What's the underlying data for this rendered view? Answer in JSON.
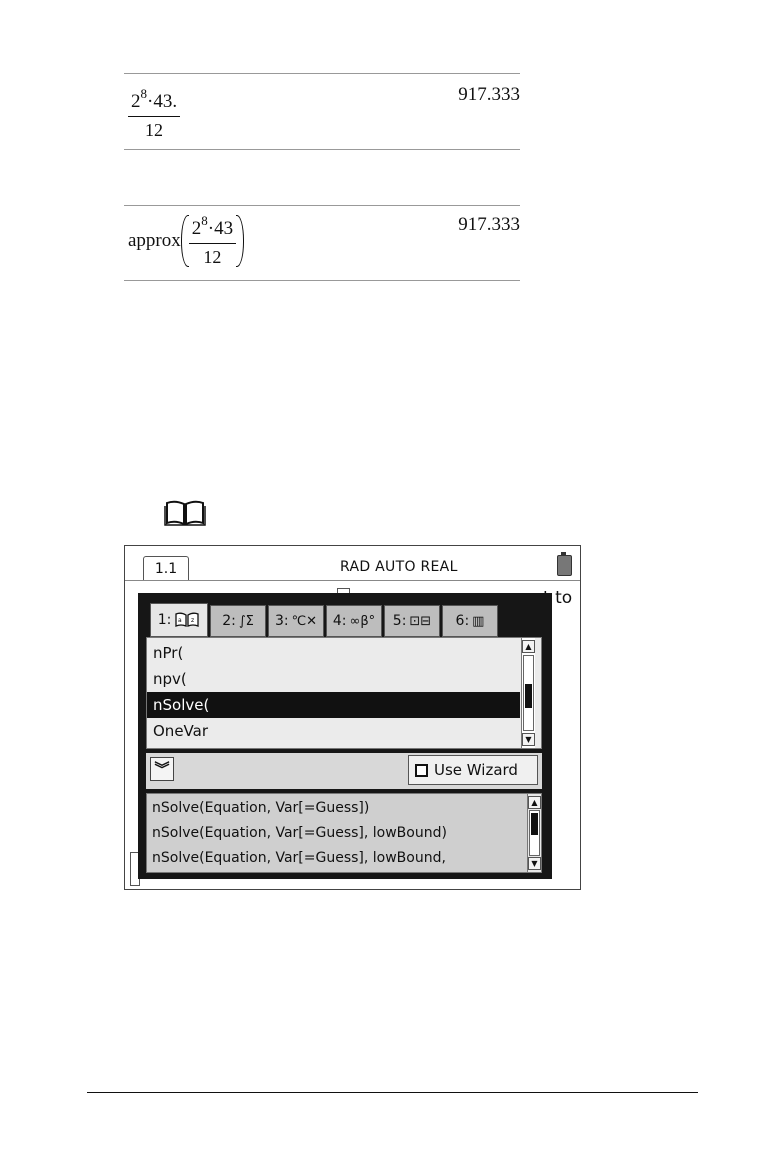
{
  "history": [
    {
      "func": "",
      "base": "2",
      "exp": "8",
      "num_rest": "·43.",
      "den": "12",
      "result": "917.333"
    },
    {
      "func": "approx",
      "base": "2",
      "exp": "8",
      "num_rest": "·43",
      "den": "12",
      "result": "917.333"
    }
  ],
  "icons": {
    "reference": "open-book-icon"
  },
  "screen": {
    "page_tab": "1.1",
    "mode": "RAD AUTO REAL",
    "bg_text": "t to",
    "catalog": {
      "tabs": [
        {
          "label": "1:",
          "glyph": "📖",
          "icon": "alphabetical-book-icon"
        },
        {
          "label": "2:",
          "glyph": "∫Σ",
          "icon": "math-templates-icon"
        },
        {
          "label": "3:",
          "glyph": "℃✕",
          "icon": "unit-conversion-icon"
        },
        {
          "label": "4:",
          "glyph": "∞β°",
          "icon": "symbols-icon"
        },
        {
          "label": "5:",
          "glyph": "⊡⊟",
          "icon": "templates-icon"
        },
        {
          "label": "6:",
          "glyph": "▥",
          "icon": "libraries-icon"
        }
      ],
      "items": [
        "nPr(",
        "npv(",
        "nSolve(",
        "OneVar"
      ],
      "selected_index": 2,
      "wizard_label": "Use Wizard",
      "help_lines": [
        "nSolve(Equation, Var[=Guess])",
        "nSolve(Equation, Var[=Guess], lowBound)",
        "nSolve(Equation, Var[=Guess], lowBound,"
      ],
      "list_scroll_position": 0.55,
      "help_scroll_position": 0.1
    }
  }
}
